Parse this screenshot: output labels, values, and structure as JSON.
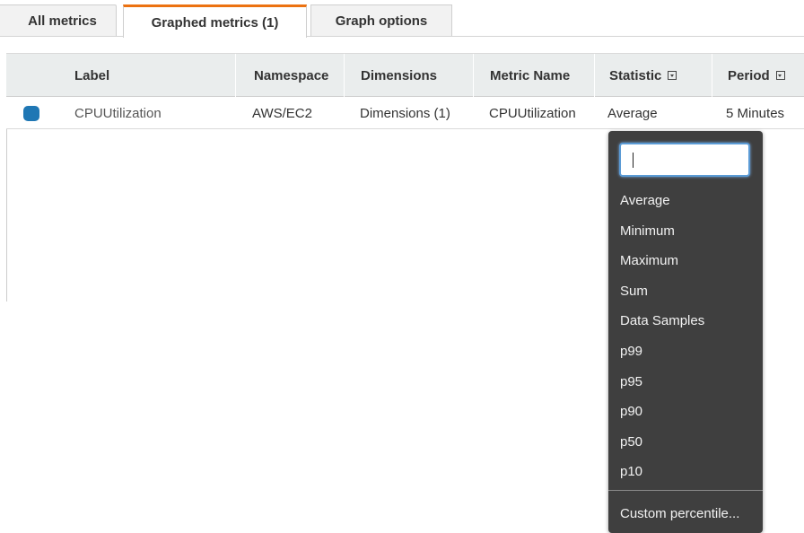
{
  "tabs": [
    {
      "label": "All metrics"
    },
    {
      "label": "Graphed metrics (1)"
    },
    {
      "label": "Graph options"
    }
  ],
  "table": {
    "headers": {
      "label": "Label",
      "namespace": "Namespace",
      "dimensions": "Dimensions",
      "metric_name": "Metric Name",
      "statistic": "Statistic",
      "period": "Period"
    },
    "rows": [
      {
        "color": "#1f77b4",
        "label": "CPUUtilization",
        "namespace": "AWS/EC2",
        "dimensions": "Dimensions (1)",
        "metric_name": "CPUUtilization",
        "statistic": "Average",
        "period": "5 Minutes"
      }
    ]
  },
  "statistic_dropdown": {
    "search_value": "",
    "options": [
      "Average",
      "Minimum",
      "Maximum",
      "Sum",
      "Data Samples",
      "p99",
      "p95",
      "p90",
      "p50",
      "p10"
    ],
    "custom_option": "Custom percentile..."
  },
  "colors": {
    "active_tab_accent": "#ec7211",
    "dropdown_bg": "#3f3f3f",
    "series_color": "#1f77b4"
  }
}
